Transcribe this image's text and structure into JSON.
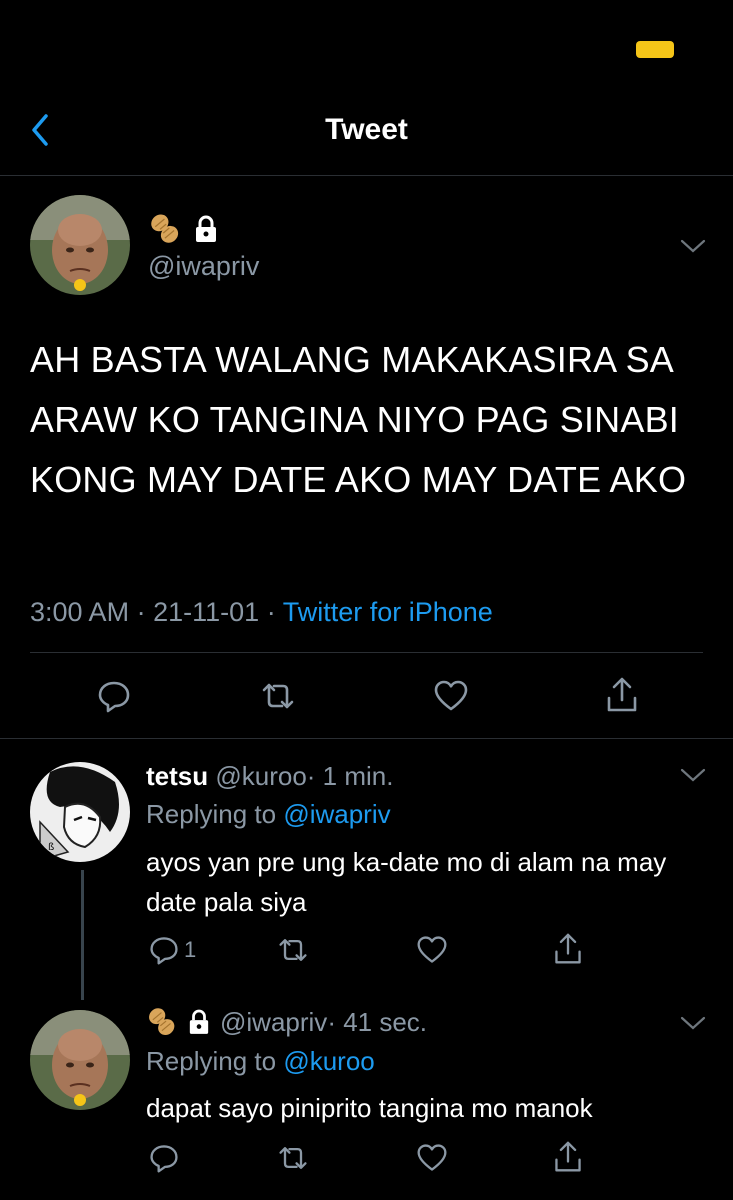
{
  "status_bar": {
    "battery_color": "#f5c518"
  },
  "header": {
    "title": "Tweet",
    "back_icon": "chevron-left-icon",
    "accent": "#1d9bf0"
  },
  "tweet": {
    "handle": "@iwapriv",
    "name_icons": [
      "peanut-icon",
      "lock-icon"
    ],
    "text": "AH BASTA WALANG MAKAKASIRA SA ARAW KO TANGINA NIYO PAG SINABI KONG MAY DATE AKO MAY DATE AKO",
    "time": "3:00 AM",
    "separator": "·",
    "date": "21-11-01",
    "source": "Twitter for iPhone",
    "actions": [
      "reply-icon",
      "retweet-icon",
      "like-icon",
      "share-icon"
    ]
  },
  "replies": [
    {
      "name": "tetsu",
      "handle": "@kuroo",
      "time": "· 1 min.",
      "replying_prefix": "Replying to",
      "replying_to": "@iwapriv",
      "text": "ayos yan pre ung ka-date mo di alam na may date pala siya",
      "reply_count": "1"
    },
    {
      "name_icons": [
        "peanut-icon",
        "lock-icon"
      ],
      "handle": "@iwapriv",
      "time": "· 41 sec.",
      "replying_prefix": "Replying to",
      "replying_to": "@kuroo",
      "text": "dapat sayo piniprito tangina mo manok"
    }
  ]
}
